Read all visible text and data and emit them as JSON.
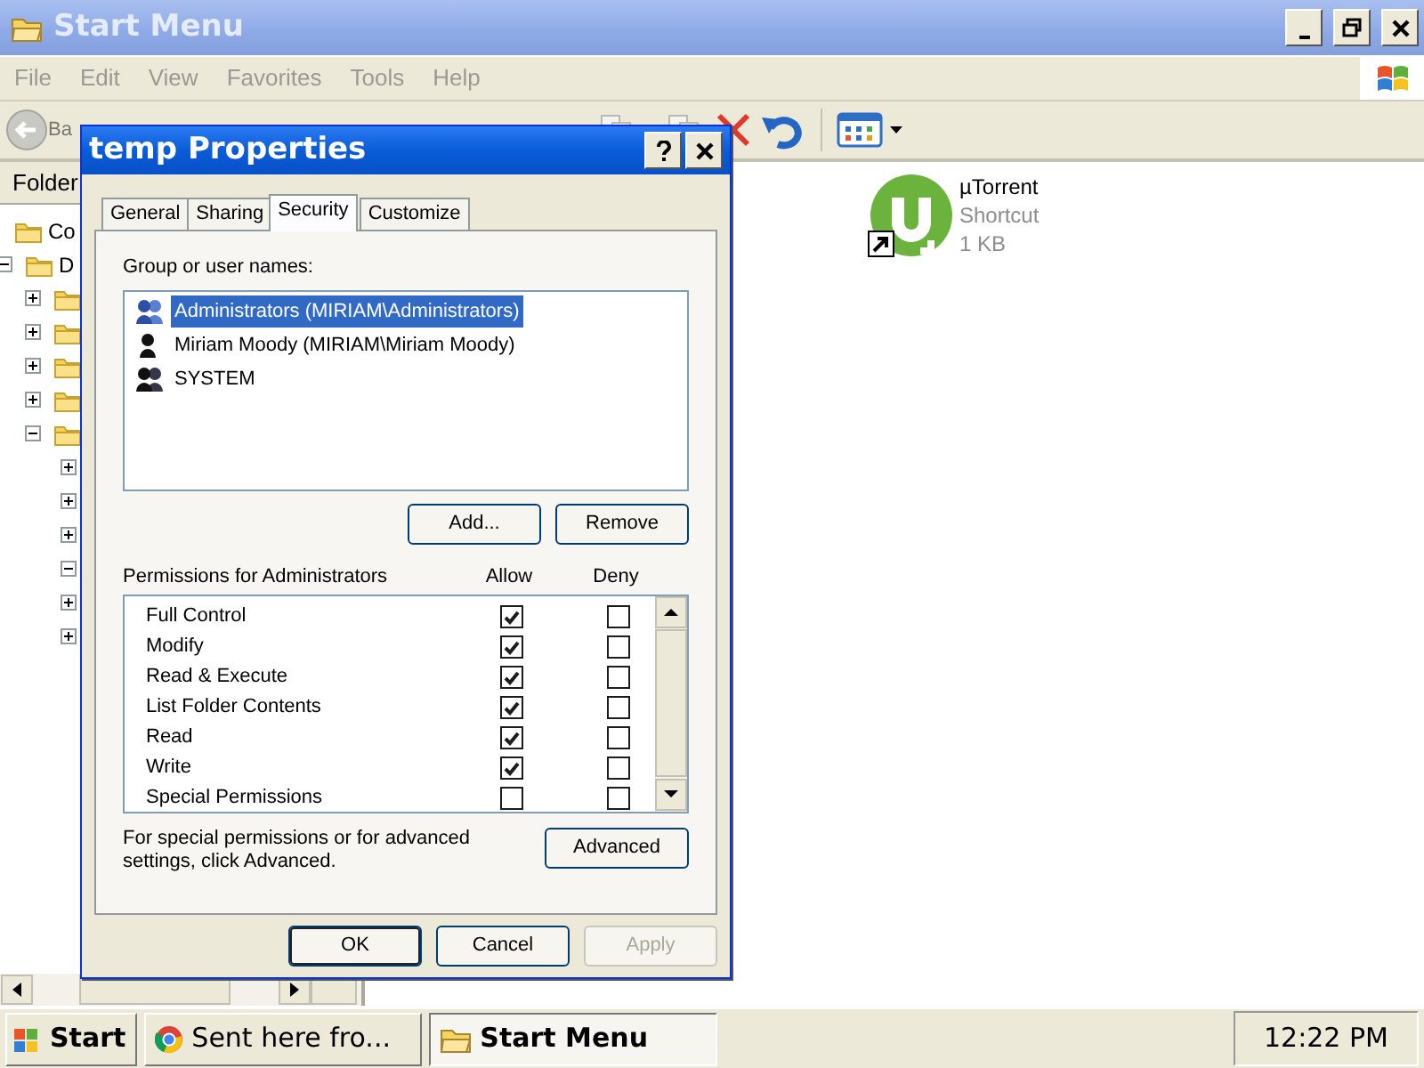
{
  "explorer": {
    "title": "Start Menu",
    "menu": [
      "File",
      "Edit",
      "View",
      "Favorites",
      "Tools",
      "Help"
    ],
    "back_label": "Ba",
    "folders_header": "Folder",
    "tree": [
      {
        "label": "Co"
      },
      {
        "label": "D",
        "expanded": true,
        "children": [
          {
            "expanded": false
          },
          {
            "expanded": false
          },
          {
            "expanded": false
          },
          {
            "expanded": false
          },
          {
            "expanded": true,
            "children": [
              {
                "expanded": false
              },
              {
                "expanded": false
              },
              {
                "expanded": false
              },
              {
                "expanded": true
              },
              {
                "expanded": false
              },
              {
                "expanded": false
              }
            ]
          }
        ]
      }
    ],
    "files": [
      {
        "name": "µTorrent",
        "type": "Shortcut",
        "size": "1 KB"
      }
    ]
  },
  "dialog": {
    "title": "temp Properties",
    "tabs": [
      {
        "label": "General",
        "selected": false
      },
      {
        "label": "Sharing",
        "selected": false
      },
      {
        "label": "Security",
        "selected": true
      },
      {
        "label": "Customize",
        "selected": false
      }
    ],
    "group_label": "Group or user names:",
    "users": [
      {
        "name": "Administrators (MIRIAM\\Administrators)",
        "kind": "group",
        "selected": true
      },
      {
        "name": "Miriam Moody (MIRIAM\\Miriam Moody)",
        "kind": "user",
        "selected": false
      },
      {
        "name": "SYSTEM",
        "kind": "group",
        "selected": false
      }
    ],
    "user_buttons": [
      "Add...",
      "Remove"
    ],
    "permissions_label": "Permissions for Administrators",
    "allow_header": "Allow",
    "deny_header": "Deny",
    "permissions": [
      {
        "name": "Full Control",
        "allow": true,
        "deny": false
      },
      {
        "name": "Modify",
        "allow": true,
        "deny": false
      },
      {
        "name": "Read & Execute",
        "allow": true,
        "deny": false
      },
      {
        "name": "List Folder Contents",
        "allow": true,
        "deny": false
      },
      {
        "name": "Read",
        "allow": true,
        "deny": false
      },
      {
        "name": "Write",
        "allow": true,
        "deny": false
      },
      {
        "name": "Special Permissions",
        "allow": false,
        "deny": false
      }
    ],
    "advanced_note": "For special permissions or for advanced settings, click Advanced.",
    "advanced_button": "Advanced",
    "buttons": [
      {
        "label": "OK",
        "default": true,
        "disabled": false
      },
      {
        "label": "Cancel",
        "default": false,
        "disabled": false
      },
      {
        "label": "Apply",
        "default": false,
        "disabled": true
      }
    ]
  },
  "taskbar": {
    "start": "Start",
    "tasks": [
      {
        "label": "Sent here fro...",
        "kind": "browser",
        "selected": false
      },
      {
        "label": "Start Menu",
        "kind": "folder",
        "selected": true
      }
    ],
    "clock": "12:22 PM"
  }
}
